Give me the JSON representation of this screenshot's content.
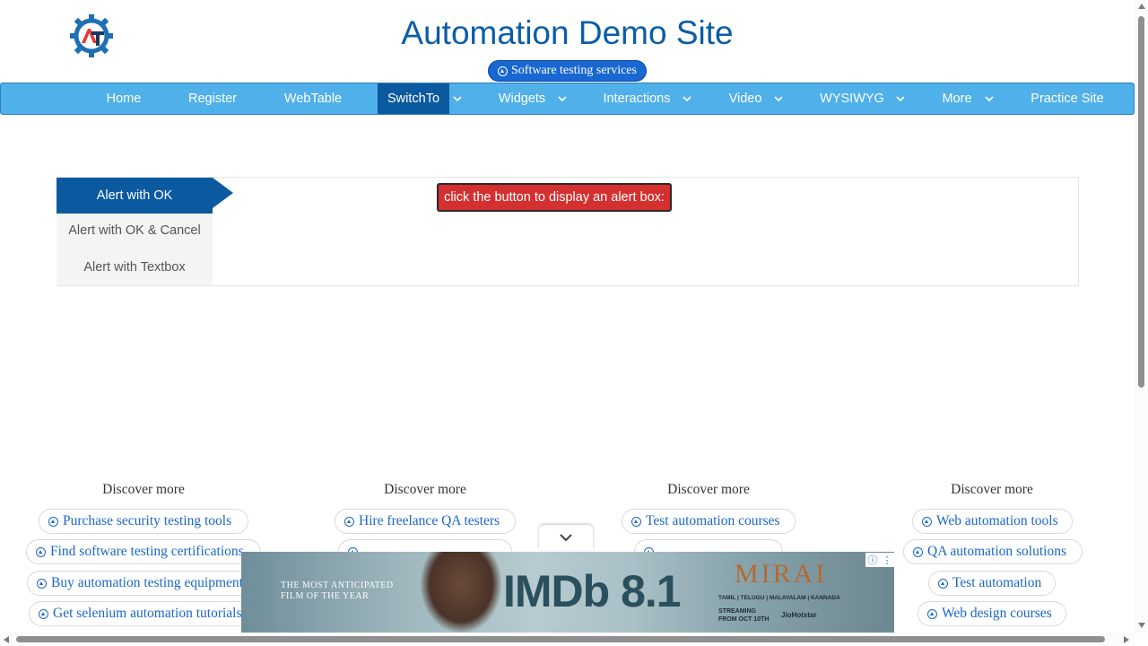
{
  "header": {
    "site_title": "Automation Demo Site",
    "services_pill": "Software testing services"
  },
  "navbar": {
    "items": [
      {
        "label": "Home",
        "has_dropdown": false,
        "active": false
      },
      {
        "label": "Register",
        "has_dropdown": false,
        "active": false
      },
      {
        "label": "WebTable",
        "has_dropdown": false,
        "active": false
      },
      {
        "label": "SwitchTo",
        "has_dropdown": true,
        "active": true
      },
      {
        "label": "Widgets",
        "has_dropdown": true,
        "active": false
      },
      {
        "label": "Interactions",
        "has_dropdown": true,
        "active": false
      },
      {
        "label": "Video",
        "has_dropdown": true,
        "active": false
      },
      {
        "label": "WYSIWYG",
        "has_dropdown": true,
        "active": false
      },
      {
        "label": "More",
        "has_dropdown": true,
        "active": false
      },
      {
        "label": "Practice Site",
        "has_dropdown": false,
        "active": false
      }
    ],
    "colors": {
      "bar": "#4fb0ea",
      "active": "#0b5aa0"
    }
  },
  "alerts": {
    "tabs": [
      "Alert with OK",
      "Alert with OK & Cancel",
      "Alert with Textbox"
    ],
    "active_tab": 0,
    "button_label": "click the button to display an alert box:",
    "button_color": "#d3302f"
  },
  "discover": {
    "columns": [
      {
        "heading": "Discover more",
        "links": [
          "Purchase security testing tools",
          "Find software testing certifications",
          "Buy automation testing equipment",
          "Get selenium automation tutorials"
        ]
      },
      {
        "heading": "Discover more",
        "links": [
          "Hire freelance QA testers",
          ""
        ]
      },
      {
        "heading": "Discover more",
        "links": [
          "Test automation courses",
          ""
        ]
      },
      {
        "heading": "Discover more",
        "links": [
          "Web automation tools",
          "QA automation solutions",
          "Test automation",
          "Web design courses"
        ]
      }
    ]
  },
  "ad": {
    "tagline_1": "THE MOST ANTICIPATED",
    "tagline_2": "FILM OF THE YEAR",
    "rating": "IMDb 8.1",
    "title": "MIRAI",
    "languages": "TAMIL | TELUGU | MALAYALAM | KANNADA",
    "stream_1": "STREAMING",
    "stream_2": "FROM OCT 10TH",
    "platform": "JioHotstar",
    "info_icon": "info-icon",
    "menu_icon": "kebab-icon"
  }
}
